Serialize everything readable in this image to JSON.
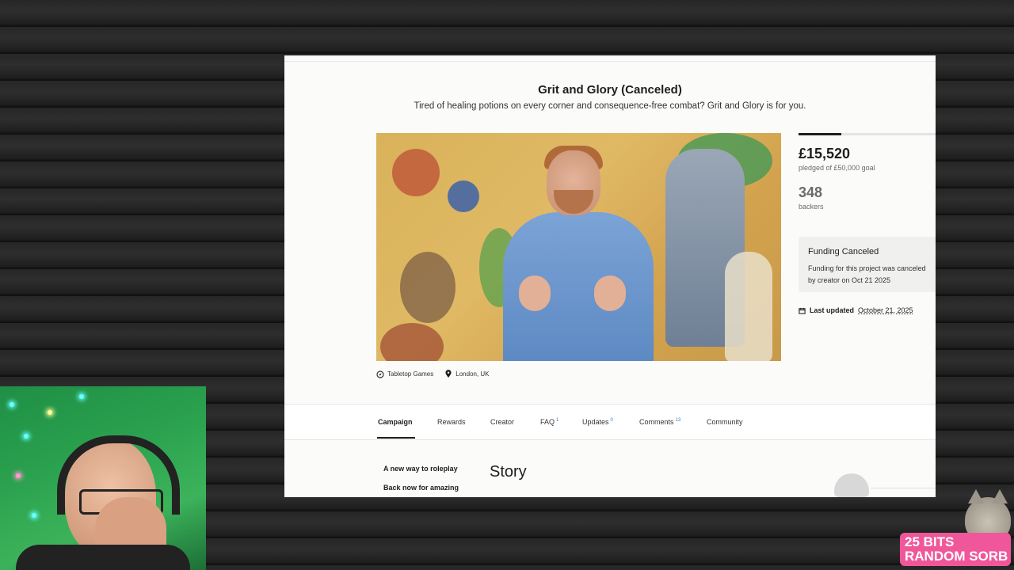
{
  "project": {
    "title": "Grit and Glory (Canceled)",
    "subtitle": "Tired of healing potions on every corner and consequence-free combat? Grit and Glory is for you."
  },
  "stats": {
    "pledged": "£15,520",
    "pledged_sub": "pledged of £50,000 goal",
    "progress_fraction": 0.31,
    "backers": "348",
    "backers_sub": "backers"
  },
  "canceled": {
    "title": "Funding Canceled",
    "text": "Funding for this project was canceled by creator on Oct 21 2025"
  },
  "updated": {
    "label": "Last updated",
    "date": "October 21, 2025"
  },
  "tags": {
    "category": "Tabletop Games",
    "location": "London, UK"
  },
  "nav": {
    "campaign": "Campaign",
    "rewards": "Rewards",
    "creator": "Creator",
    "faq": "FAQ",
    "faq_count": "1",
    "updates": "Updates",
    "updates_count": "0",
    "comments": "Comments",
    "comments_count": "13",
    "community": "Community"
  },
  "sidebar": {
    "link1": "A new way to roleplay",
    "link2": "Back now for amazing"
  },
  "section_heading": "Story",
  "overlay": {
    "badge_line1": "25 BITS",
    "badge_line2": "RANDOM SORB"
  },
  "colors": {
    "accent": "#1e1e1e",
    "badge": "#f0579a",
    "webcam_bg": "#2ba24f"
  }
}
